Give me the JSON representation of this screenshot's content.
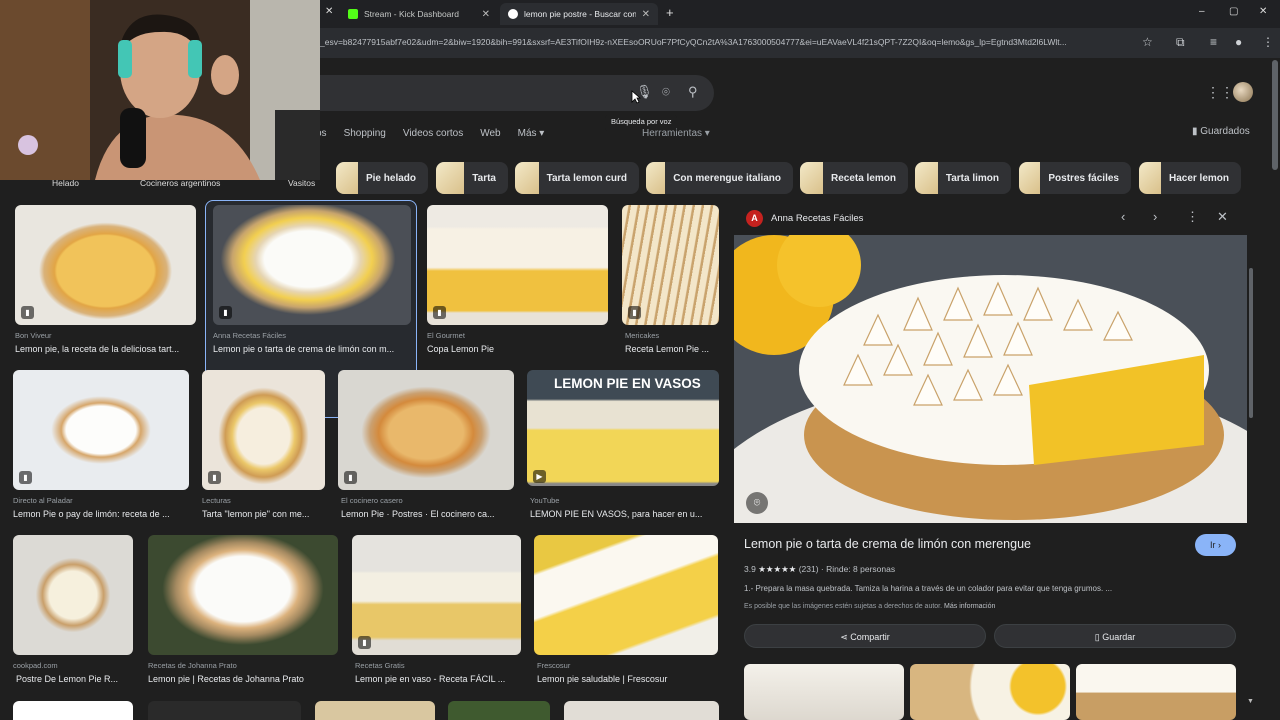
{
  "browser": {
    "tabs": [
      {
        "label": "Stream - Kick Dashboard",
        "active": false
      },
      {
        "label": "lemon pie postre - Buscar con G",
        "active": true
      }
    ],
    "new_tab": "+",
    "url": "_esv=b82477915abf7e02&udm=2&biw=1920&bih=991&sxsrf=AE3TifOIH9z-nXEEsoORUoF7PfCyQCn2tA%3A1763000504777&ei=uEAVaeVL4f21sQPT-7Z2QI&oq=lemo&gs_lp=Egtnd3Mtd2l6LWlt...",
    "win_controls": [
      "–",
      "▢",
      "✕"
    ]
  },
  "search": {
    "tooltip": "Búsqueda por voz",
    "tabs": [
      "os",
      "Shopping",
      "Videos cortos",
      "Web",
      "Más ▾"
    ],
    "tools": "Herramientas ▾",
    "saved": "Guardados"
  },
  "chips": [
    {
      "label": "Pie helado"
    },
    {
      "label": "Tarta"
    },
    {
      "label": "Tarta lemon curd"
    },
    {
      "label": "Con merengue italiano"
    },
    {
      "label": "Receta lemon"
    },
    {
      "label": "Tarta limon"
    },
    {
      "label": "Postres fáciles"
    },
    {
      "label": "Hacer lemon"
    }
  ],
  "chip_strip_cut": [
    "Helado",
    "Cocineros argentinos",
    "Vasitos"
  ],
  "results": [
    {
      "source": "Bon Viveur",
      "title": "Lemon pie, la receta de la deliciosa tart..."
    },
    {
      "source": "Anna Recetas Fáciles",
      "title": "Lemon pie o tarta de crema de limón con m..."
    },
    {
      "source": "El Gourmet",
      "title": "Copa Lemon Pie"
    },
    {
      "source": "Mericakes",
      "title": "Receta Lemon Pie ..."
    },
    {
      "source": "Directo al Paladar",
      "title": "Lemon Pie o pay de limón: receta de ..."
    },
    {
      "source": "Lecturas",
      "title": "Tarta \"lemon pie\" con me..."
    },
    {
      "source": "El cocinero casero",
      "title": "Lemon Pie · Postres · El cocinero ca..."
    },
    {
      "source": "YouTube",
      "title": "LEMON PIE EN VASOS, para hacer en u..."
    },
    {
      "source": "cookpad.com",
      "title": "Postre De Lemon Pie R..."
    },
    {
      "source": "Recetas de Johanna Prato",
      "title": "Lemon pie | Recetas de Johanna Prato"
    },
    {
      "source": "Recetas Gratis",
      "title": "Lemon pie en vaso - Receta FÁCIL ..."
    },
    {
      "source": "Frescosur",
      "title": "Lemon pie saludable | Frescosur"
    }
  ],
  "video_overlay_text": "LEMON PIE EN VASOS",
  "panel": {
    "source": "Anna Recetas Fáciles",
    "logo_letter": "A",
    "title": "Lemon pie o tarta de crema de limón con merengue",
    "go_button": "Ir ›",
    "rating_value": "3.9",
    "stars": "★★★★★",
    "rating_count": "(231)",
    "servings": "· Rinde: 8 personas",
    "description": "1.- Prepara la masa quebrada. Tamiza la harina a través de un colador para evitar que tenga grumos. ...",
    "copyright": "Es posible que las imágenes estén sujetas a derechos de autor.",
    "more_info": "Más información",
    "share": "Compartir",
    "save": "Guardar"
  },
  "colors": {
    "accent": "#8ab4f8",
    "bg": "#1f1f1f",
    "surface": "#303134"
  }
}
